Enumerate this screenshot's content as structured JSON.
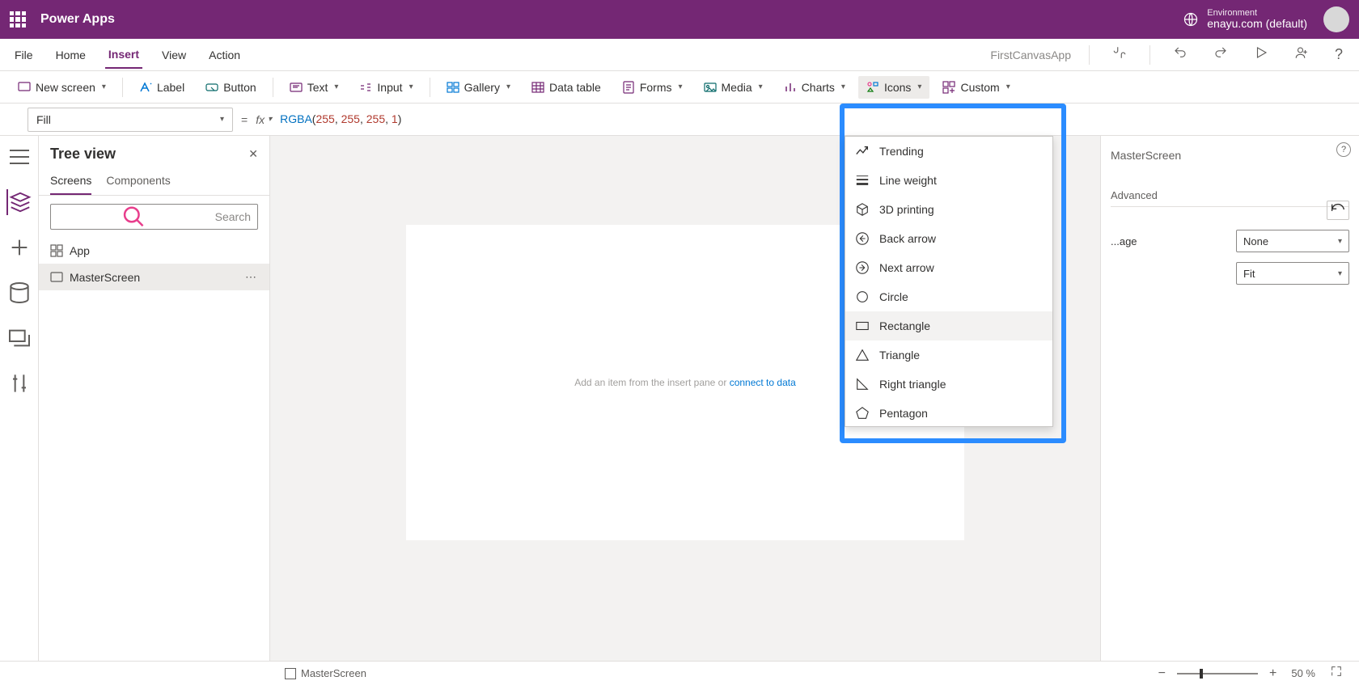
{
  "titlebar": {
    "app": "Power Apps",
    "env_label": "Environment",
    "env_value": "enayu.com (default)"
  },
  "menubar": {
    "items": [
      "File",
      "Home",
      "Insert",
      "View",
      "Action"
    ],
    "active": 2,
    "appname": "FirstCanvasApp"
  },
  "ribbon": {
    "newscreen": "New screen",
    "label": "Label",
    "button": "Button",
    "text": "Text",
    "input": "Input",
    "gallery": "Gallery",
    "datatable": "Data table",
    "forms": "Forms",
    "media": "Media",
    "charts": "Charts",
    "icons": "Icons",
    "custom": "Custom"
  },
  "formulabar": {
    "property": "Fill",
    "fn": "RGBA",
    "a1": "255",
    "a2": "255",
    "a3": "255",
    "a4": "1"
  },
  "tree": {
    "title": "Tree view",
    "tabs": [
      "Screens",
      "Components"
    ],
    "search": "Search",
    "app": "App",
    "screen": "MasterScreen"
  },
  "canvas": {
    "hint_pre": "Add an item from the insert pane",
    "hint_or": " or ",
    "hint_link": "connect to data"
  },
  "rightpanel": {
    "selname": "MasterScreen",
    "tab_adv": "Advanced",
    "prop1_label": "Background image",
    "prop1_short": "...age",
    "prop1_value": "None",
    "prop2_value": "Fit"
  },
  "dropdown": {
    "items": [
      "Trending",
      "Line weight",
      "3D printing",
      "Back arrow",
      "Next arrow",
      "Circle",
      "Rectangle",
      "Triangle",
      "Right triangle",
      "Pentagon"
    ]
  },
  "statusbar": {
    "screen": "MasterScreen",
    "zoom": "50  %"
  }
}
